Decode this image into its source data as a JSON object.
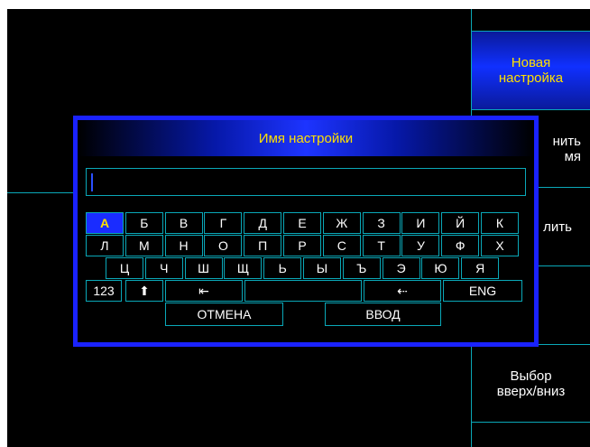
{
  "softkeys": [
    {
      "label": "",
      "active": false
    },
    {
      "label": "Новая\nнастройка",
      "active": true
    },
    {
      "label": "нить\nмя",
      "active": false
    },
    {
      "label": "лить",
      "active": false
    },
    {
      "label": "",
      "active": false
    },
    {
      "label": "Выбор\nвверх/вниз",
      "active": false
    },
    {
      "label": "",
      "active": false
    }
  ],
  "dialog": {
    "title": "Имя настройки",
    "input_value": ""
  },
  "keyboard": {
    "selected": "А",
    "rows": [
      [
        "А",
        "Б",
        "В",
        "Г",
        "Д",
        "Е",
        "Ж",
        "З",
        "И",
        "Й",
        "К"
      ],
      [
        "Л",
        "М",
        "Н",
        "О",
        "П",
        "Р",
        "С",
        "Т",
        "У",
        "Ф",
        "Х"
      ],
      [
        "Ц",
        "Ч",
        "Ш",
        "Щ",
        "Ь",
        "Ы",
        "Ъ",
        "Э",
        "Ю",
        "Я"
      ]
    ],
    "row4": {
      "numbers": "123",
      "shift": "⬆",
      "cursor_home": "⇤",
      "space": "",
      "backspace": "⇠",
      "language": "ENG"
    },
    "cancel": "ОТМЕНА",
    "enter": "ВВОД"
  },
  "colors": {
    "accent_blue": "#1a22ff",
    "active_text": "#ffe000",
    "grid_line": "#0aa8b8"
  }
}
